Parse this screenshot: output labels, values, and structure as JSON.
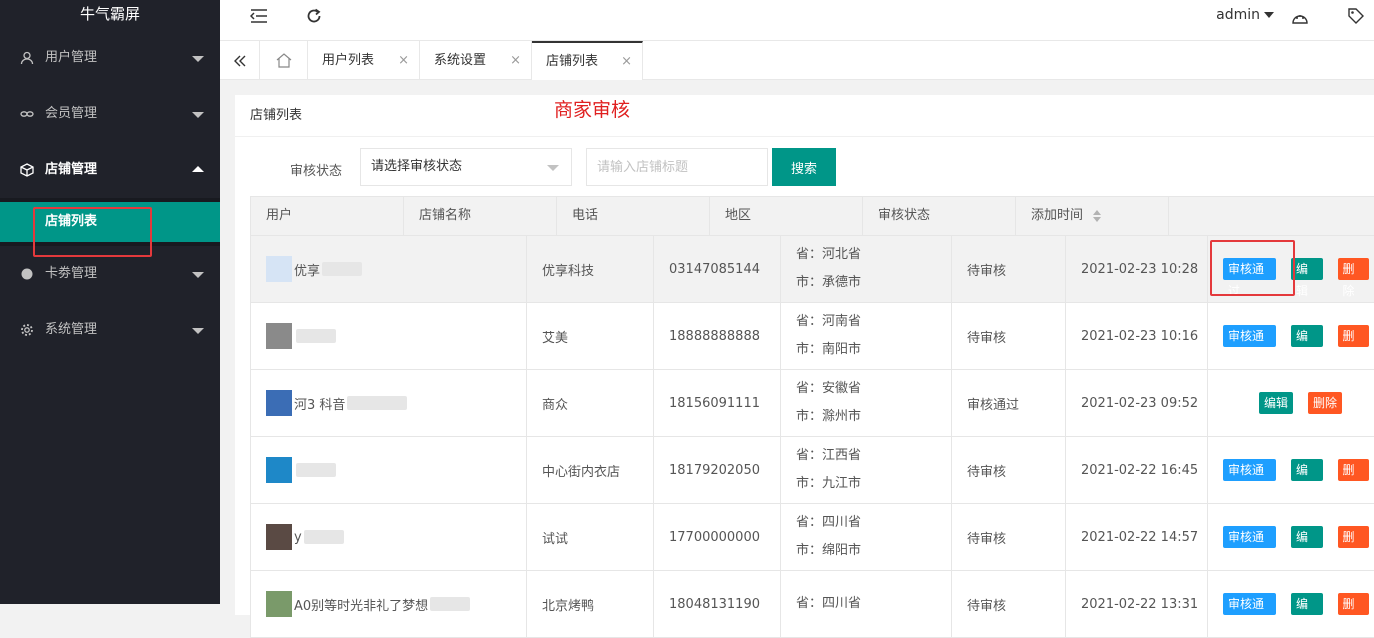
{
  "sidebar": {
    "logo": "牛气霸屏",
    "items": [
      {
        "label": "用户管理",
        "icon": "user-icon"
      },
      {
        "label": "会员管理",
        "icon": "link-icon"
      },
      {
        "label": "店铺管理",
        "icon": "cube-icon"
      },
      {
        "label": "卡劵管理",
        "icon": "circle-icon"
      },
      {
        "label": "系统管理",
        "icon": "gear-icon"
      }
    ],
    "active_sub": "店铺列表"
  },
  "header": {
    "user": "admin"
  },
  "tabs": [
    {
      "label": "用户列表",
      "close": "×"
    },
    {
      "label": "系统设置",
      "close": "×"
    },
    {
      "label": "店铺列表",
      "close": "×"
    }
  ],
  "card": {
    "title": "店铺列表",
    "annotation": "商家审核"
  },
  "filter": {
    "status_label": "审核状态",
    "status_select": "请选择审核状态",
    "title_placeholder": "请输入店铺标题",
    "search_label": "搜索"
  },
  "table": {
    "headers": [
      "用户",
      "店铺名称",
      "电话",
      "地区",
      "审核状态",
      "添加时间"
    ],
    "rows": [
      {
        "user": "优享",
        "store": "优享科技",
        "phone": "03147085144",
        "province": "省：河北省",
        "city": "市：承德市",
        "status": "待审核",
        "time": "2021-02-23 10:28"
      },
      {
        "user": "",
        "store": "艾美",
        "phone": "18888888888",
        "province": "省：河南省",
        "city": "市：南阳市",
        "status": "待审核",
        "time": "2021-02-23 10:16"
      },
      {
        "user": "河3 科音",
        "store": "商众",
        "phone": "18156091111",
        "province": "省：安徽省",
        "city": "市：滁州市",
        "status": "审核通过",
        "time": "2021-02-23 09:52"
      },
      {
        "user": "",
        "store": "中心街内衣店",
        "phone": "18179202050",
        "province": "省：江西省",
        "city": "市：九江市",
        "status": "待审核",
        "time": "2021-02-22 16:45"
      },
      {
        "user": "y",
        "store": "试试",
        "phone": "17700000000",
        "province": "省：四川省",
        "city": "市：绵阳市",
        "status": "待审核",
        "time": "2021-02-22 14:57"
      },
      {
        "user": "A0别等时光非礼了梦想",
        "store": "北京烤鸭",
        "phone": "18048131190",
        "province": "省：四川省",
        "city": "",
        "status": "待审核",
        "time": "2021-02-22 13:31"
      }
    ]
  },
  "actions": {
    "approve": "审核通过",
    "edit": "编辑",
    "delete": "删除"
  },
  "colors": {
    "sidebar_bg": "#20222a",
    "accent": "#009688",
    "approve": "#1e9fff",
    "delete": "#ff5722",
    "highlight": "#e4393c"
  }
}
